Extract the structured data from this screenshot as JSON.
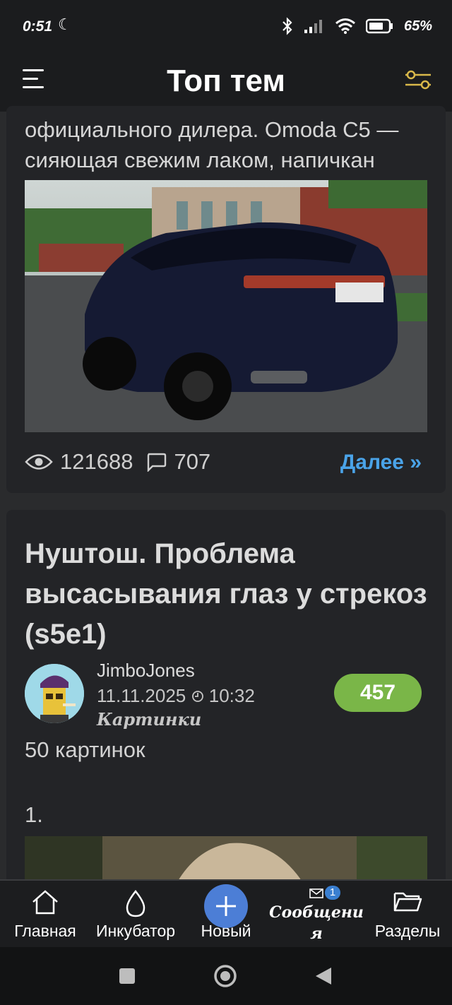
{
  "status_bar": {
    "time": "0:51",
    "battery_percent": "65%",
    "icons": [
      "moon-icon",
      "bluetooth-icon",
      "signal-icon",
      "wifi-icon",
      "battery-icon"
    ]
  },
  "app_bar": {
    "title": "Топ тем",
    "menu_icon": "hamburger-menu-icon",
    "filter_icon": "filter-sliders-icon"
  },
  "post1": {
    "excerpt_line1": "официального дилера. Omoda C5 —",
    "excerpt_line2": "сияющая свежим лаком, напичкан",
    "views": "121688",
    "comments": "707",
    "more_label": "Далее »"
  },
  "post2": {
    "title": "Нуштош. Проблема высасывания глаз у стрекоз (s5e1)",
    "author": "JimboJones",
    "date": "11.11.2025",
    "time": "10:32",
    "category": "Картинки",
    "score": "457",
    "body": "50 картинок",
    "item_number": "1."
  },
  "bottom_nav": {
    "home": "Главная",
    "incubator": "Инкубатор",
    "new": "Новый",
    "messages_line1": "Сообщени",
    "messages_line2": "я",
    "messages_badge": "1",
    "sections": "Разделы"
  },
  "colors": {
    "background": "#2a2b2d",
    "card": "#232427",
    "accent_link": "#4aa3e8",
    "score_green": "#7ab648",
    "fab_blue": "#4c7ed6",
    "filter_icon_gold": "#d9b84a"
  }
}
